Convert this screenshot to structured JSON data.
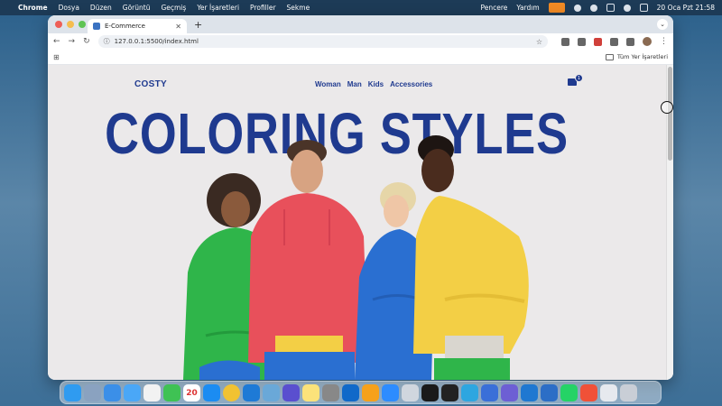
{
  "menubar": {
    "app": "Chrome",
    "menus": [
      "Dosya",
      "Düzen",
      "Görüntü",
      "Geçmiş",
      "Yer İşaretleri",
      "Profiller",
      "Sekme"
    ],
    "right_menus": [
      "Pencere",
      "Yardım"
    ],
    "clock": "20 Oca Pzt  21:58"
  },
  "browser": {
    "tab_title": "E-Commerce",
    "url": "127.0.0.1:5500/index.html",
    "bookmarks_label": "Tüm Yer İşaretleri"
  },
  "site": {
    "logo": "COSTY",
    "nav": [
      "Woman",
      "Man",
      "Kids",
      "Accessories"
    ],
    "cart_count": "1",
    "hero_title": "COLORING STYLES"
  },
  "colors": {
    "brand_blue": "#1f3a8f",
    "page_bg": "#ebe9ea",
    "hoodie_green": "#2fb54a",
    "hoodie_red": "#e8505b",
    "hoodie_blue": "#2a6fd1",
    "hoodie_yellow": "#f3cf45"
  },
  "dock": {
    "calendar_day": "20",
    "icons": [
      "finder-icon",
      "launchpad-icon",
      "safari-icon",
      "mail-icon",
      "photos-icon",
      "facetime-icon",
      "calendar-icon",
      "appstore-icon",
      "chrome-icon",
      "vscode-icon",
      "preview-icon",
      "imovie-icon",
      "notes-icon",
      "settings-icon",
      "outlook-icon",
      "pencil-icon",
      "zoom-icon",
      "image-icon",
      "github-icon",
      "terminal-icon",
      "telegram-icon",
      "vpn-icon",
      "screenshot-icon",
      "xcode-icon",
      "instruments-icon",
      "whatsapp-icon",
      "swift-icon",
      "tablet-icon",
      "trash-icon"
    ]
  }
}
